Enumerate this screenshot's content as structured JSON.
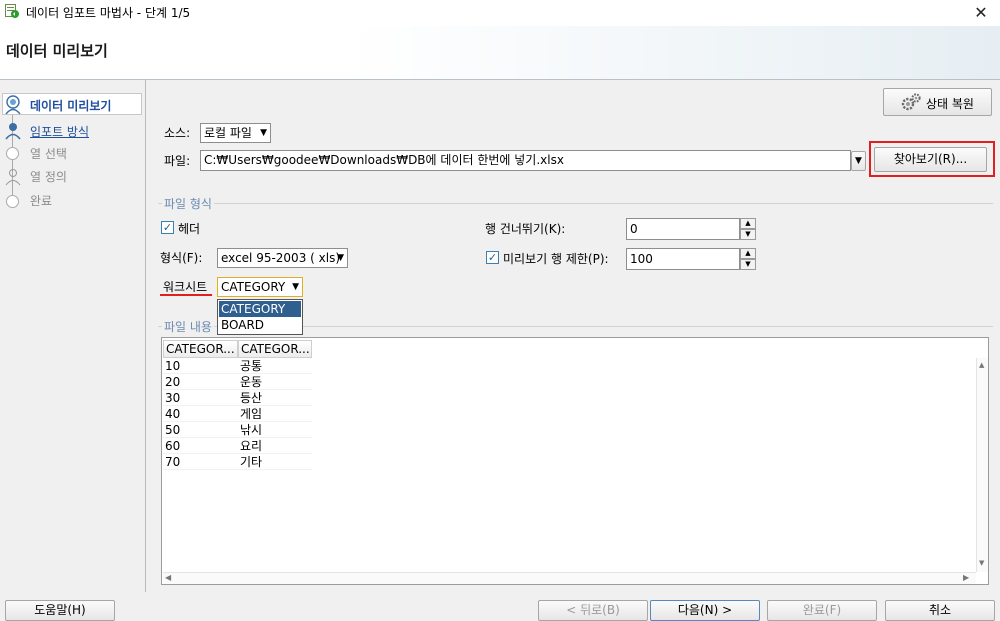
{
  "window": {
    "title": "데이터 임포트 마법사 - 단계 1/5",
    "close_glyph": "✕"
  },
  "header": {
    "title": "데이터 미리보기"
  },
  "nav": {
    "steps": [
      {
        "label": "데이터 미리보기",
        "state": "active"
      },
      {
        "label": "임포트 방식",
        "state": "link"
      },
      {
        "label": "열 선택",
        "state": "disabled"
      },
      {
        "label": "열 정의",
        "state": "disabled"
      },
      {
        "label": "완료",
        "state": "disabled"
      }
    ]
  },
  "toolbar": {
    "restore_label": "상태 복원"
  },
  "source": {
    "label": "소스:",
    "value": "로컬 파일"
  },
  "file": {
    "label": "파일:",
    "value": "C:₩Users₩goodee₩Downloads₩DB에 데이터 한번에 넣기.xlsx",
    "browse_label": "찾아보기(R)..."
  },
  "format_group": {
    "title": "파일 형식",
    "header_label": "헤더",
    "header_checked": true,
    "format_label": "형식(F):",
    "format_value": "excel 95-2003 ( xls)",
    "worksheet_label": "워크시트",
    "worksheet_value": "CATEGORY",
    "worksheet_options": [
      "CATEGORY",
      "BOARD"
    ],
    "skip_label": "행 건너뛰기(K):",
    "skip_value": "0",
    "limit_label": "미리보기 행 제한(P):",
    "limit_checked": true,
    "limit_value": "100"
  },
  "content_group": {
    "title": "파일 내용",
    "columns": [
      "CATEGOR...",
      "CATEGOR..."
    ],
    "rows": [
      [
        "10",
        "공통"
      ],
      [
        "20",
        "운동"
      ],
      [
        "30",
        "등산"
      ],
      [
        "40",
        "게임"
      ],
      [
        "50",
        "낚시"
      ],
      [
        "60",
        "요리"
      ],
      [
        "70",
        "기타"
      ]
    ]
  },
  "footer": {
    "help": "도움말(H)",
    "back": "< 뒤로(B)",
    "next": "다음(N) >",
    "finish": "완료(F)",
    "cancel": "취소"
  },
  "colors": {
    "accent_highlight": "#2f5f8f",
    "annotation_red": "#e02020",
    "link_blue": "#1f4e9c"
  }
}
